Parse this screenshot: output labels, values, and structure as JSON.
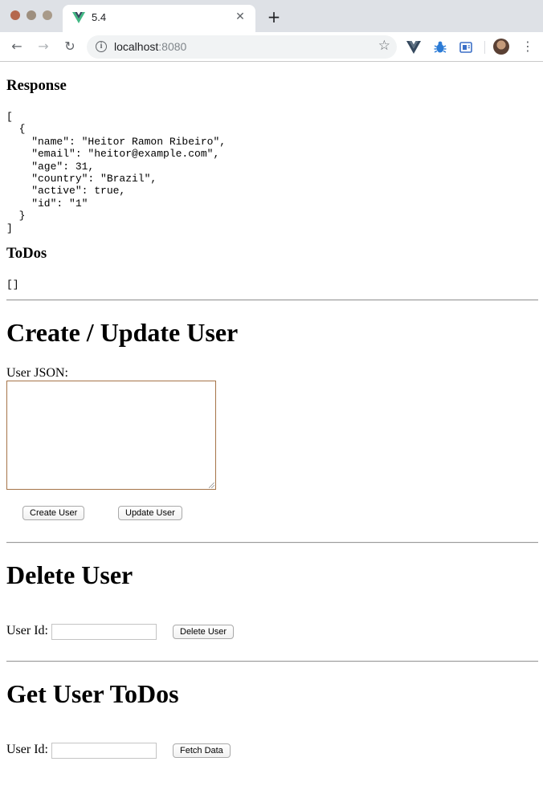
{
  "browser": {
    "tab_title": "5.4",
    "tab_close_glyph": "✕",
    "new_tab_glyph": "+",
    "url_host": "localhost",
    "url_port": ":8080",
    "back_glyph": "←",
    "forward_glyph": "→",
    "reload_glyph": "↻",
    "info_glyph": "i",
    "star_glyph": "☆",
    "menu_glyph": "⋮",
    "icons": {
      "tab_favicon": "vue-logo-icon",
      "ext_1": "vue-devtools-icon",
      "ext_2": "bug-icon",
      "ext_3": "extension-box-icon",
      "avatar": "profile-avatar"
    },
    "colors": {
      "vue_green": "#41b883",
      "vue_dark": "#35495e",
      "tab_strip": "#dee1e6"
    }
  },
  "response": {
    "heading": "Response",
    "json": "[\n  {\n    \"name\": \"Heitor Ramon Ribeiro\",\n    \"email\": \"heitor@example.com\",\n    \"age\": 31,\n    \"country\": \"Brazil\",\n    \"active\": true,\n    \"id\": \"1\"\n  }\n]"
  },
  "todos": {
    "heading": "ToDos",
    "json": "[]"
  },
  "create_update": {
    "heading": "Create / Update User",
    "label": "User JSON:",
    "textarea_value": "",
    "create_button": "Create User",
    "update_button": "Update User"
  },
  "delete_user": {
    "heading": "Delete User",
    "label": "User Id:",
    "input_value": "",
    "button": "Delete User"
  },
  "get_todos": {
    "heading": "Get User ToDos",
    "label": "User Id:",
    "input_value": "",
    "button": "Fetch Data"
  }
}
